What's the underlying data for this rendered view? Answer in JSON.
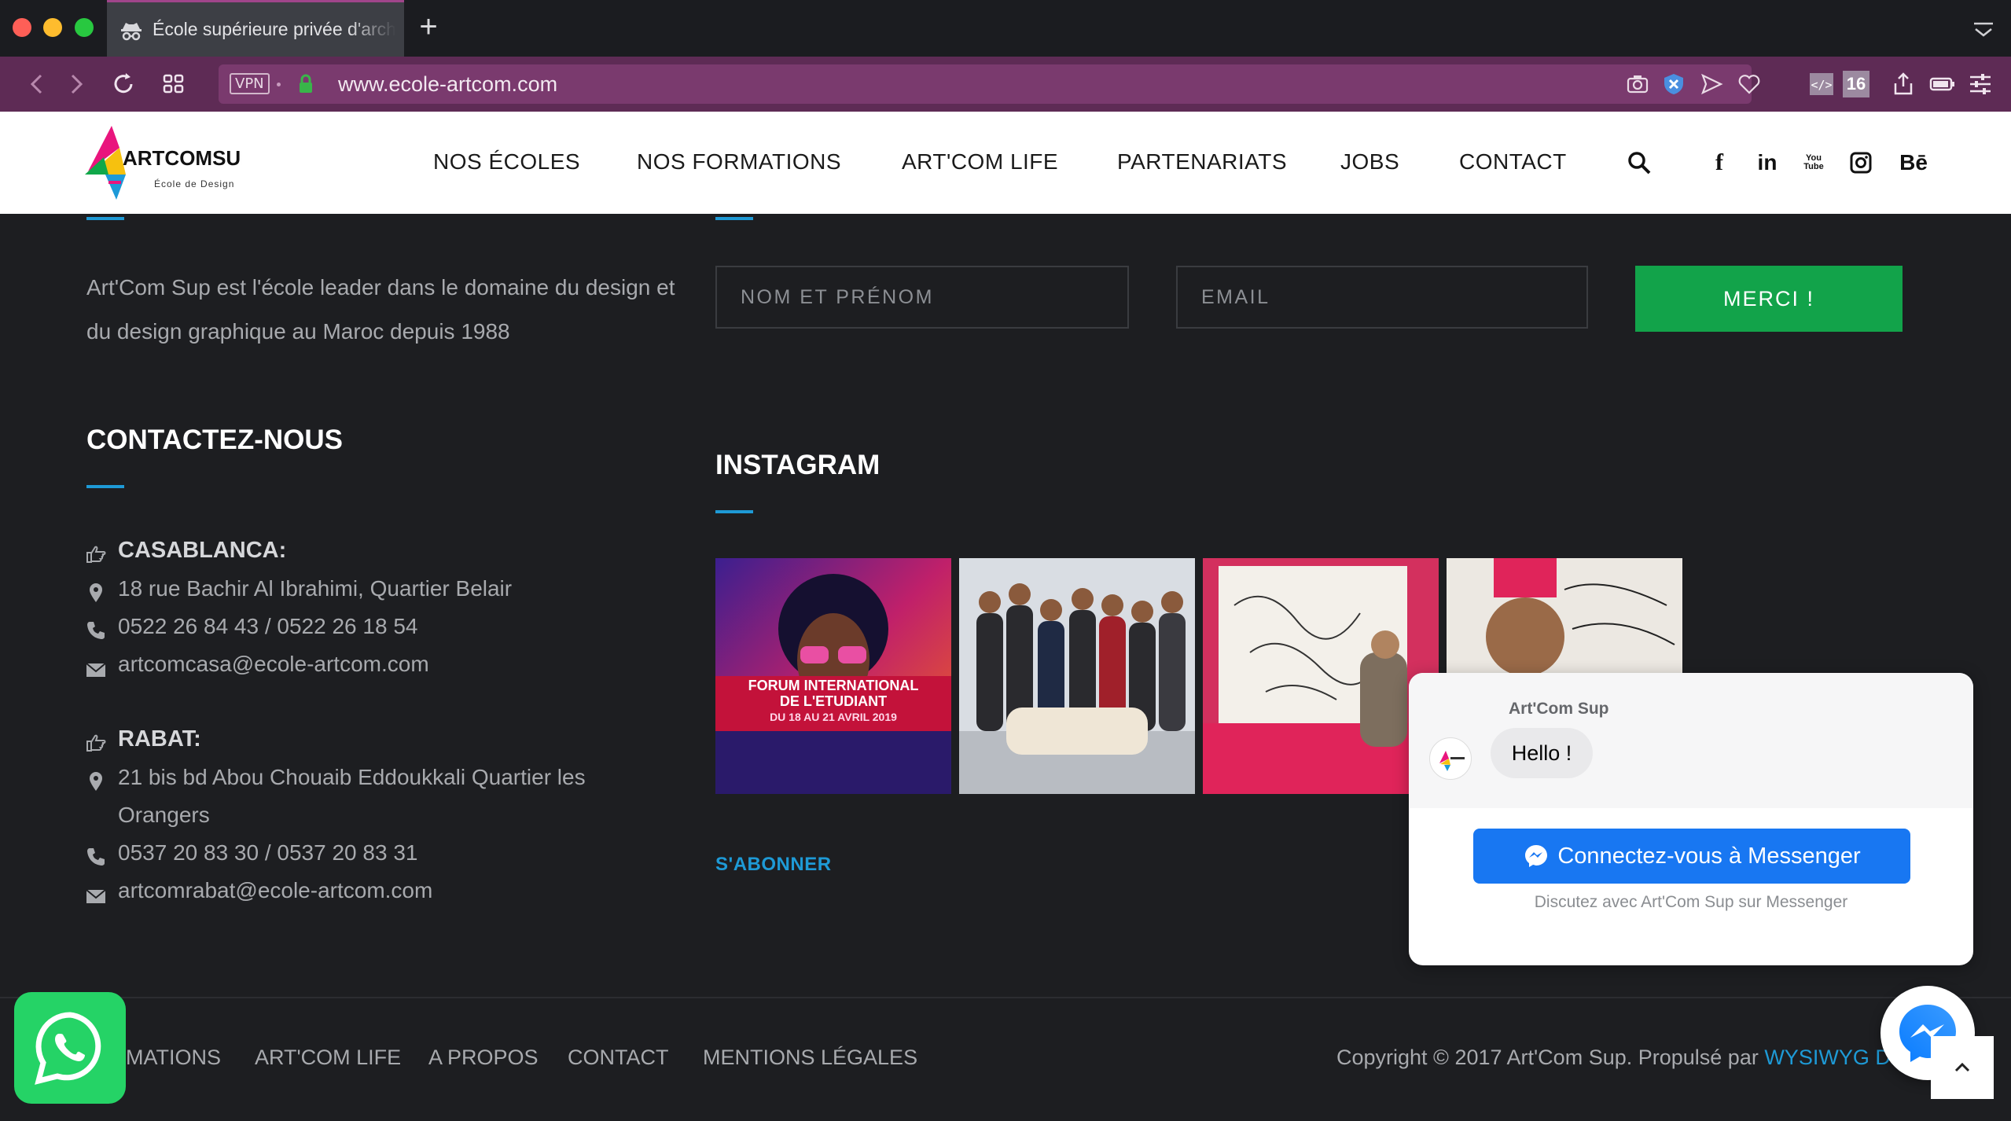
{
  "browser": {
    "tab_title": "École supérieure privée d'architecture",
    "new_tab_label": "+",
    "vpn_label": "VPN",
    "url": "www.ecole-artcom.com",
    "badge_count": "16"
  },
  "header": {
    "logo_text": "ARTCOMSUP",
    "logo_sub": "École de Design",
    "nav": [
      "NOS ÉCOLES",
      "NOS FORMATIONS",
      "ART'COM LIFE",
      "PARTENARIATS",
      "JOBS",
      "CONTACT"
    ],
    "social": [
      "f",
      "in",
      "You Tube",
      "Bē"
    ]
  },
  "about_text": "Art'Com Sup est l'école leader dans le domaine du design et du design graphique au Maroc depuis 1988",
  "newsletter": {
    "name_placeholder": "NOM ET PRÉNOM",
    "email_placeholder": "EMAIL",
    "submit_label": "MERCI !"
  },
  "contact": {
    "title": "CONTACTEZ-NOUS",
    "casablanca": {
      "city": "CASABLANCA:",
      "address": "18 rue Bachir Al Ibrahimi, Quartier Belair",
      "phone": "0522 26 84 43 / 0522 26 18 54",
      "email": "artcomcasa@ecole-artcom.com"
    },
    "rabat": {
      "city": "RABAT:",
      "address_line1": "21 bis bd Abou Chouaib Eddoukkali Quartier les",
      "address_line2": "Orangers",
      "phone": "0537 20 83 30 / 0537 20 83 31",
      "email": "artcomrabat@ecole-artcom.com"
    }
  },
  "instagram": {
    "title": "INSTAGRAM",
    "subscribe_label": "S'ABONNER",
    "post1_line1": "FORUM INTERNATIONAL",
    "post1_line2": "DE L'ETUDIANT",
    "post1_line3": "DU 18 AU 21 AVRIL 2019"
  },
  "footer_nav": [
    "MATIONS",
    "ART'COM LIFE",
    "A PROPOS",
    "CONTACT",
    "MENTIONS LÉGALES"
  ],
  "copyright": {
    "text": "Copyright © 2017 Art'Com Sup. Propulsé par ",
    "link": "WYSIWYG Di"
  },
  "messenger": {
    "page_name": "Art'Com Sup",
    "greeting": "Hello !",
    "button_label": "Connectez-vous à Messenger",
    "subtitle": "Discutez avec Art'Com Sup sur Messenger"
  },
  "colors": {
    "accent_blue": "#1e9ad6",
    "merci_green": "#12a34a",
    "urlbar_purple": "#5e2b55",
    "messenger_blue": "#1877f2",
    "whatsapp_green": "#25d366"
  }
}
